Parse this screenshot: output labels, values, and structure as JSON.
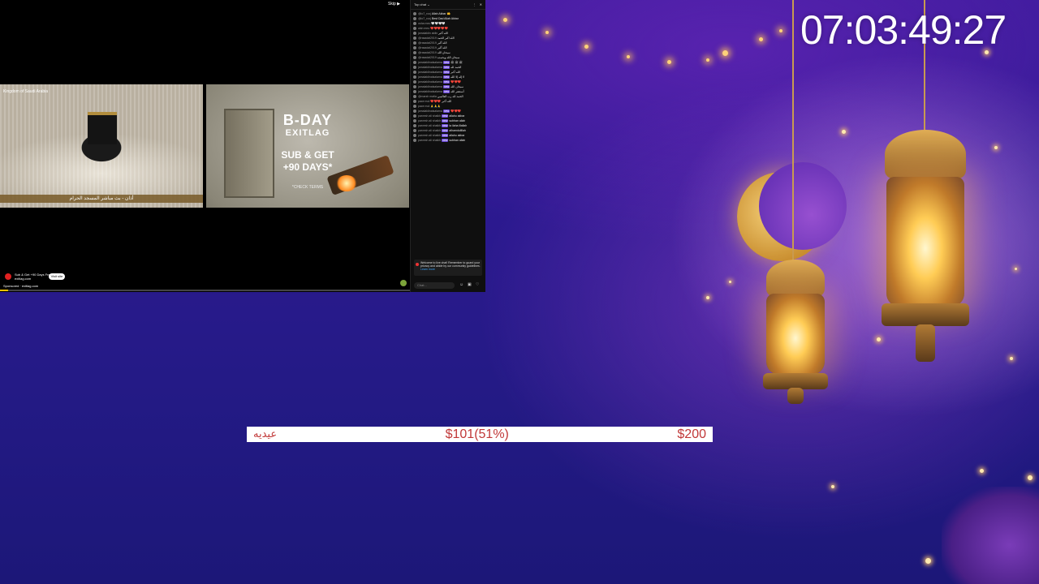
{
  "clock": {
    "time": "07:03:49:27"
  },
  "goal": {
    "label": "عيديه",
    "progress_text": "$101(51%)",
    "target": "$200",
    "progress_fraction": 0.51
  },
  "stream": {
    "skip_label": "Skip ▶",
    "kaaba_caption": "أذان - بث مباشر المسجد الحرام",
    "kaaba_top_text": "Kingdom of Saudi Arabia",
    "ad": {
      "title": "B-DAY",
      "brand": "EXITLAG",
      "line1": "SUB & GET",
      "line2": "+90 DAYS*",
      "terms": "*CHECK TERMS"
    },
    "channel_name": "Sub & Get +90 Days Free",
    "channel_sub": "exitlag.com",
    "visit_label": "Visit site",
    "sponsored_label": "Sponsored · exitlag.com",
    "progress_fraction": 0.02
  },
  "chat": {
    "header": "Top chat ⌄",
    "lines": [
      {
        "name": "@lo7_rooj",
        "badge": "",
        "text": "Allah Akbar 🤲"
      },
      {
        "name": "@lo7_rooj",
        "badge": "",
        "text": "Best Dad Allah Akbar"
      },
      {
        "name": "osha meo",
        "badge": "",
        "text": "🤍🤍🤍🤍"
      },
      {
        "name": "alsh meo",
        "badge": "",
        "text": "❤️❤️❤️❤️❤️"
      },
      {
        "name": "jamalaldin aldin",
        "badge": "",
        "text": "الله أكبر"
      },
      {
        "name": "@rasadal2019",
        "badge": "",
        "text": "الله اكبر الحمد"
      },
      {
        "name": "@rasadal2019",
        "badge": "",
        "text": "الله أكبر"
      },
      {
        "name": "@rasadal2019",
        "badge": "",
        "text": "الله أكبر"
      },
      {
        "name": "@rasadal2019",
        "badge": "",
        "text": "سبحان الله"
      },
      {
        "name": "@rasadal2019",
        "badge": "",
        "text": "سبحان الله وبحمده"
      },
      {
        "name": "jamalaldinalsalama",
        "badge": "new",
        "text": "ﷺ ﷺ ﷺ"
      },
      {
        "name": "jamalaldinalsalama",
        "badge": "new",
        "text": "الحمد لله"
      },
      {
        "name": "jamalaldinalsalama",
        "badge": "new",
        "text": "الله أكبر"
      },
      {
        "name": "jamalaldinalsalama",
        "badge": "new",
        "text": "لا إله إلا الله"
      },
      {
        "name": "jamalaldinalsalama",
        "badge": "new",
        "text": "❤️❤️❤️"
      },
      {
        "name": "jamalaldinalsalama",
        "badge": "new",
        "text": "سبحان الله"
      },
      {
        "name": "jamalaldinalsalama",
        "badge": "new",
        "text": "أستغفر الله"
      },
      {
        "name": "@marsh matia",
        "badge": "",
        "text": "الحمد لله رب العالمين"
      },
      {
        "name": "pace mol",
        "badge": "",
        "text": "❤️❤️❤️ الله أكبر"
      },
      {
        "name": "pace mol",
        "badge": "",
        "text": "🙏🙏🙏"
      },
      {
        "name": "jamalaldinalsalama",
        "badge": "new",
        "text": "❤️❤️❤️"
      },
      {
        "name": "parvesh ali shaikh",
        "badge": "new",
        "text": "allahu akbar"
      },
      {
        "name": "parvesh ali shaikh",
        "badge": "new",
        "text": "subhan allah"
      },
      {
        "name": "parvesh ali shaikh",
        "badge": "new",
        "text": "la ilaha illallah"
      },
      {
        "name": "parvesh ali shaikh",
        "badge": "new",
        "text": "alhamdulillah"
      },
      {
        "name": "parvesh ali shaikh",
        "badge": "new",
        "text": "allahu akbar"
      },
      {
        "name": "parvesh ali shaikh",
        "badge": "new",
        "text": "subhan allah"
      }
    ],
    "notice": "Welcome to live chat! Remember to guard your privacy and abide by our community guidelines.",
    "notice_link": "Learn more",
    "input_placeholder": "Chat..."
  },
  "colors": {
    "goal_text": "#c13838",
    "clock_text": "#ffffff",
    "background": "#2c1990"
  }
}
